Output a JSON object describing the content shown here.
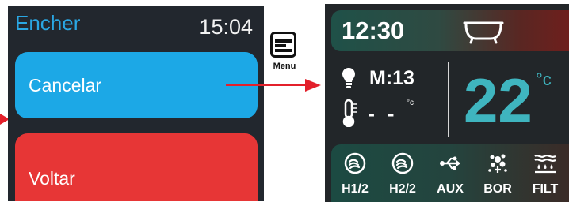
{
  "left_screen": {
    "title": "Encher",
    "time": "15:04",
    "buttons": {
      "cancel": "Cancelar",
      "back": "Voltar"
    }
  },
  "menu": {
    "label": "Menu"
  },
  "right_screen": {
    "time": "12:30",
    "status": {
      "light": "M:13",
      "water_temp_small": "- -",
      "small_unit": "°c",
      "temperature": "22",
      "temperature_unit": "°c"
    },
    "bottom_bar": [
      {
        "label": "H1/2",
        "icon": "jet-swirl-icon"
      },
      {
        "label": "H2/2",
        "icon": "jet-swirl-icon"
      },
      {
        "label": "AUX",
        "icon": "aux-usb-icon"
      },
      {
        "label": "BOR",
        "icon": "bubbles-icon"
      },
      {
        "label": "FILT",
        "icon": "filter-waves-icon"
      }
    ]
  },
  "colors": {
    "title_blue": "#2aa7e3",
    "cancel_button": "#1ca8e6",
    "back_button": "#e73636",
    "arrow_red": "#e3202b",
    "temperature_teal": "#3fb5bf"
  }
}
